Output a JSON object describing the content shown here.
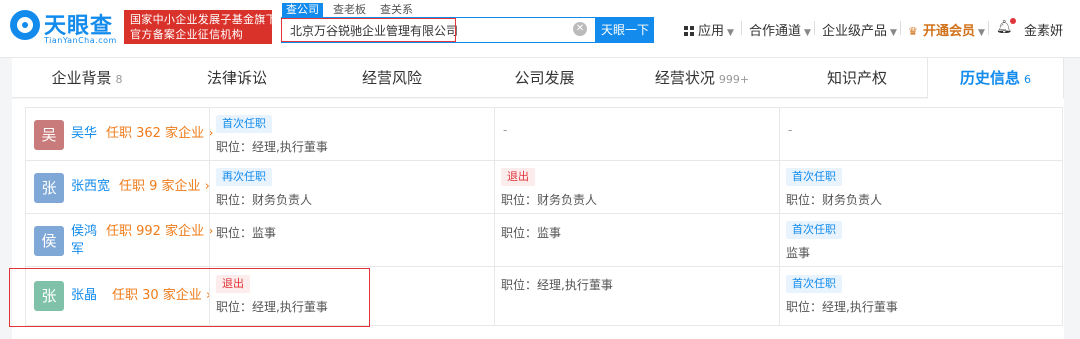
{
  "header": {
    "logo_text": "天眼查",
    "logo_sub": "TianYanCha.com",
    "badge_line1": "国家中小企业发展子基金旗下",
    "badge_line2": "官方备案企业征信机构",
    "search_tabs": [
      "查公司",
      "查老板",
      "查关系"
    ],
    "search_value": "北京万谷锐驰企业管理有限公司",
    "search_button": "天眼一下",
    "nav": {
      "apps": "应用",
      "cooperation": "合作通道",
      "enterprise": "企业级产品",
      "vip": "开通会员",
      "user": "金素妍"
    }
  },
  "tabs": [
    {
      "label": "企业背景",
      "count": "8"
    },
    {
      "label": "法律诉讼",
      "count": ""
    },
    {
      "label": "经营风险",
      "count": ""
    },
    {
      "label": "公司发展",
      "count": ""
    },
    {
      "label": "经营状况",
      "count": "999+"
    },
    {
      "label": "知识产权",
      "count": ""
    },
    {
      "label": "历史信息",
      "count": "6"
    }
  ],
  "rows": [
    {
      "avatar_char": "吴",
      "avatar_color": "#c97a7a",
      "name": "吴华",
      "name2": "",
      "count": "任职 362 家企业 ›",
      "cols": [
        {
          "tag": "首次任职",
          "tag_color": "blue",
          "position": "职位：经理,执行董事"
        },
        {
          "dash": "-"
        },
        {
          "dash": "-"
        }
      ]
    },
    {
      "avatar_char": "张",
      "avatar_color": "#7fa8d6",
      "name": "张西宽",
      "name2": "",
      "count": "任职 9 家企业 ›",
      "cols": [
        {
          "tag": "再次任职",
          "tag_color": "blue",
          "position": "职位：财务负责人"
        },
        {
          "tag": "退出",
          "tag_color": "red",
          "position": "职位：财务负责人"
        },
        {
          "tag": "首次任职",
          "tag_color": "blue",
          "position": "职位：财务负责人"
        }
      ]
    },
    {
      "avatar_char": "侯",
      "avatar_color": "#7fa8d6",
      "name": "侯鸿",
      "name2": "军",
      "count": "任职 992 家企业 ›",
      "cols": [
        {
          "tag": "",
          "position": "职位：监事"
        },
        {
          "tag": "",
          "position": "职位：监事"
        },
        {
          "tag": "首次任职",
          "tag_color": "blue",
          "position": "监事"
        }
      ]
    },
    {
      "avatar_char": "张",
      "avatar_color": "#7fc2a9",
      "name": "张晶",
      "name2": "",
      "count": "任职 30 家企业 ›",
      "cols": [
        {
          "tag": "退出",
          "tag_color": "red",
          "position": "职位：经理,执行董事"
        },
        {
          "tag": "",
          "position": "职位：经理,执行董事"
        },
        {
          "tag": "首次任职",
          "tag_color": "blue",
          "position": "职位：经理,执行董事"
        }
      ]
    }
  ]
}
